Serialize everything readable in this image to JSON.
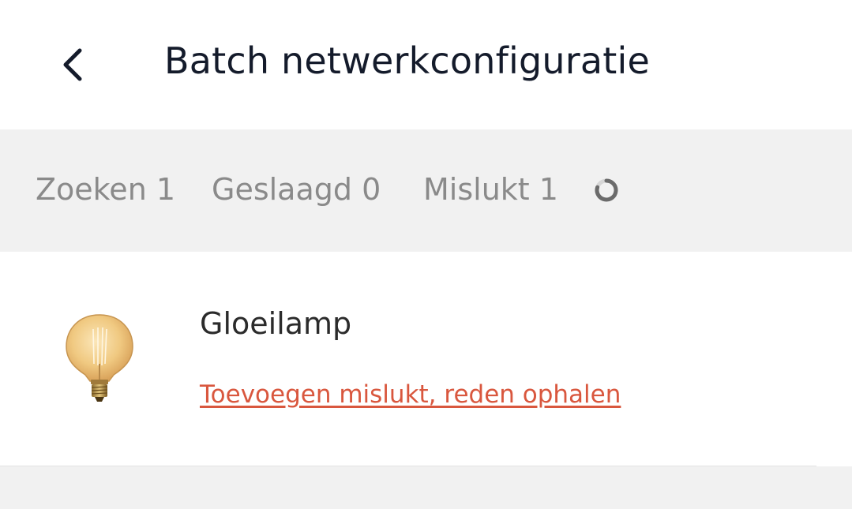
{
  "header": {
    "title": "Batch netwerkconfiguratie",
    "back_icon": "chevron-left-icon"
  },
  "status": {
    "searching": "Zoeken 1",
    "succeeded": "Geslaagd 0",
    "failed": "Mislukt 1",
    "spinner_icon": "loading-spinner-icon"
  },
  "devices": [
    {
      "name": "Gloeilamp",
      "icon": "filament-bulb-icon",
      "status_link": "Toevoegen mislukt, reden ophalen"
    }
  ],
  "colors": {
    "title": "#141b2b",
    "status_text": "#8a8a8a",
    "status_bg": "#f1f1f1",
    "error_link": "#d9573e"
  }
}
